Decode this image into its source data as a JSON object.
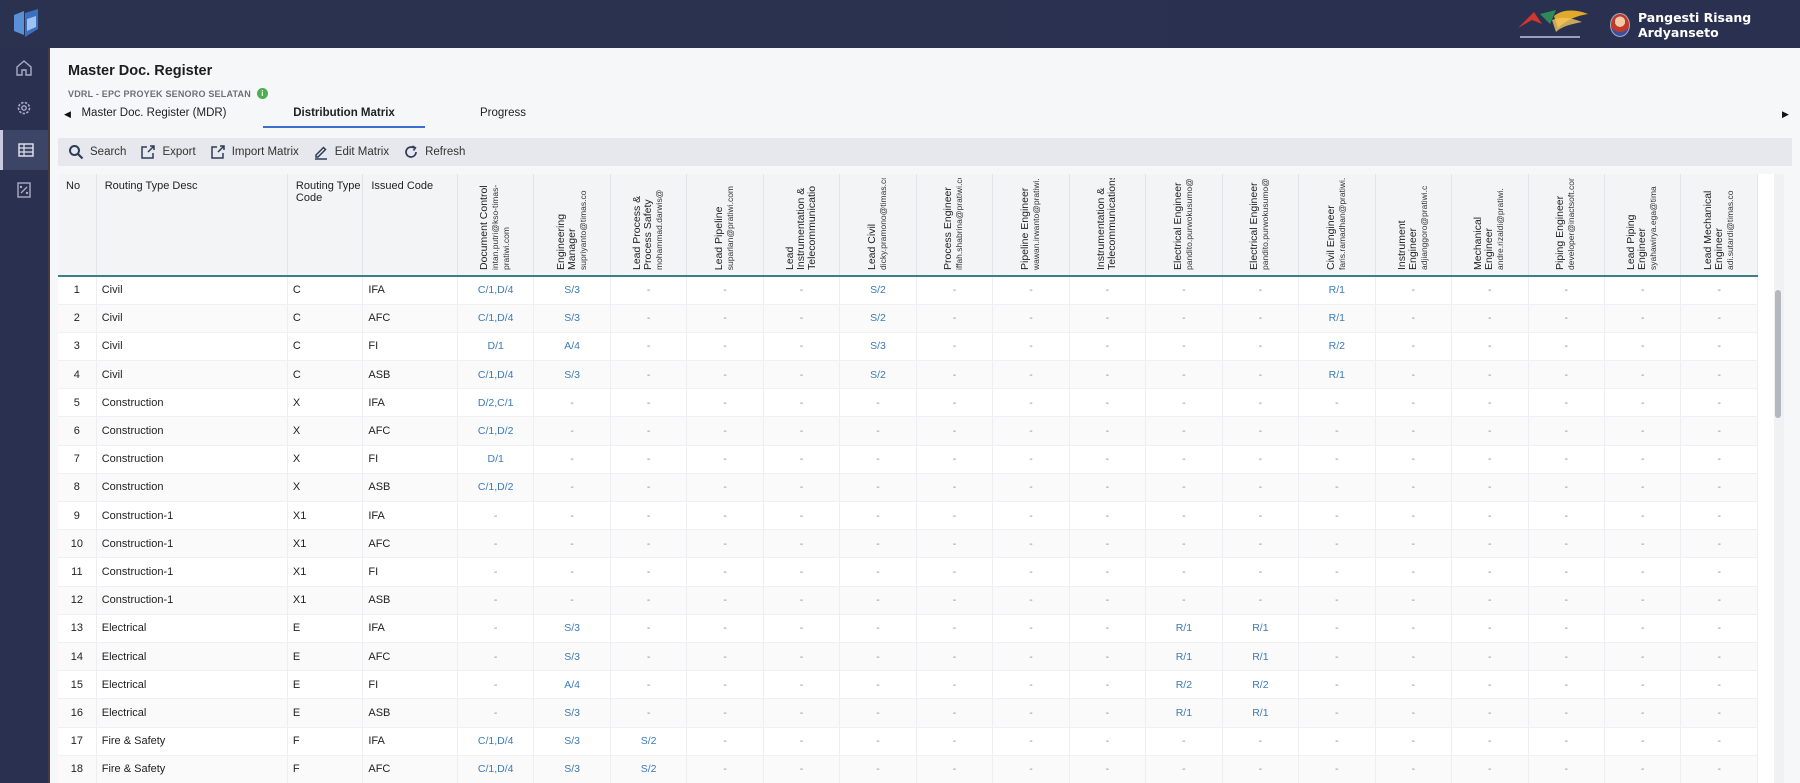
{
  "user": {
    "name": "Pangesti Risang Ardyanseto"
  },
  "rail": {
    "items": [
      "home-icon",
      "gear-icon",
      "grid-icon",
      "report-icon"
    ]
  },
  "page": {
    "title": "Master Doc. Register",
    "subtitle": "VDRL - EPC PROYEK SENORO SELATAN"
  },
  "tabs": [
    {
      "label": "Master Doc. Register (MDR)",
      "active": false
    },
    {
      "label": "Distribution Matrix",
      "active": true
    },
    {
      "label": "Progress",
      "active": false
    }
  ],
  "toolbar": {
    "search": "Search",
    "export": "Export",
    "import": "Import Matrix",
    "edit": "Edit Matrix",
    "refresh": "Refresh"
  },
  "table": {
    "fixed_headers": [
      "No",
      "Routing Type Desc",
      "Routing Type Code",
      "Issued Code"
    ],
    "role_headers": [
      {
        "title": "Document Control",
        "email": "intan.putri@kso-timas-pratiwi.com"
      },
      {
        "title": "Engineering Manager",
        "email": "supriyanto@timas.co"
      },
      {
        "title": "Lead Process & Process Safety",
        "email": "mohammad.darwis@"
      },
      {
        "title": "Lead Pipeline",
        "email": "suparlan@pratiwi.com"
      },
      {
        "title": "Lead Instrumentation & Telecommunicatio",
        "email": ""
      },
      {
        "title": "Lead Civil",
        "email": "dicky.pramono@timas.com"
      },
      {
        "title": "Process Engineer",
        "email": "iffah.shabrina@pratiwi.com"
      },
      {
        "title": "Pipeline Engineer",
        "email": "wawan.irwanto@pratiwi.com"
      },
      {
        "title": "Instrumentation & Telecommunications",
        "email": ""
      },
      {
        "title": "Electrical Engineer",
        "email": "pandito.purwokusumo@pratiwi.com"
      },
      {
        "title": "Electrical Engineer",
        "email": "pandito.purwokusumo@pratiwi.com"
      },
      {
        "title": "Civil Engineer",
        "email": "faris.ramadhan@pratiwi.com"
      },
      {
        "title": "Instrument Engineer",
        "email": "adjianggoro@pratiwi.c"
      },
      {
        "title": "Mechanical Engineer",
        "email": "andre.rizaldi@pratiwi."
      },
      {
        "title": "Piping Engineer",
        "email": "developer@inactsoft.com"
      },
      {
        "title": "Lead Piping Engineer",
        "email": "syahawirya.ega@tima"
      },
      {
        "title": "Lead Mechanical Engineer",
        "email": "adi.sutardi@timas.co"
      }
    ],
    "rows": [
      {
        "no": "1",
        "desc": "Civil",
        "type": "C",
        "issued": "IFA",
        "codes": [
          "C/1,D/4",
          "S/3",
          "-",
          "-",
          "-",
          "S/2",
          "-",
          "-",
          "-",
          "-",
          "-",
          "R/1",
          "-",
          "-",
          "-",
          "-",
          "-"
        ]
      },
      {
        "no": "2",
        "desc": "Civil",
        "type": "C",
        "issued": "AFC",
        "codes": [
          "C/1,D/4",
          "S/3",
          "-",
          "-",
          "-",
          "S/2",
          "-",
          "-",
          "-",
          "-",
          "-",
          "R/1",
          "-",
          "-",
          "-",
          "-",
          "-"
        ]
      },
      {
        "no": "3",
        "desc": "Civil",
        "type": "C",
        "issued": "FI",
        "codes": [
          "D/1",
          "A/4",
          "-",
          "-",
          "-",
          "S/3",
          "-",
          "-",
          "-",
          "-",
          "-",
          "R/2",
          "-",
          "-",
          "-",
          "-",
          "-"
        ]
      },
      {
        "no": "4",
        "desc": "Civil",
        "type": "C",
        "issued": "ASB",
        "codes": [
          "C/1,D/4",
          "S/3",
          "-",
          "-",
          "-",
          "S/2",
          "-",
          "-",
          "-",
          "-",
          "-",
          "R/1",
          "-",
          "-",
          "-",
          "-",
          "-"
        ]
      },
      {
        "no": "5",
        "desc": "Construction",
        "type": "X",
        "issued": "IFA",
        "codes": [
          "D/2,C/1",
          "-",
          "-",
          "-",
          "-",
          "-",
          "-",
          "-",
          "-",
          "-",
          "-",
          "-",
          "-",
          "-",
          "-",
          "-",
          "-"
        ]
      },
      {
        "no": "6",
        "desc": "Construction",
        "type": "X",
        "issued": "AFC",
        "codes": [
          "C/1,D/2",
          "-",
          "-",
          "-",
          "-",
          "-",
          "-",
          "-",
          "-",
          "-",
          "-",
          "-",
          "-",
          "-",
          "-",
          "-",
          "-"
        ]
      },
      {
        "no": "7",
        "desc": "Construction",
        "type": "X",
        "issued": "FI",
        "codes": [
          "D/1",
          "-",
          "-",
          "-",
          "-",
          "-",
          "-",
          "-",
          "-",
          "-",
          "-",
          "-",
          "-",
          "-",
          "-",
          "-",
          "-"
        ]
      },
      {
        "no": "8",
        "desc": "Construction",
        "type": "X",
        "issued": "ASB",
        "codes": [
          "C/1,D/2",
          "-",
          "-",
          "-",
          "-",
          "-",
          "-",
          "-",
          "-",
          "-",
          "-",
          "-",
          "-",
          "-",
          "-",
          "-",
          "-"
        ]
      },
      {
        "no": "9",
        "desc": "Construction-1",
        "type": "X1",
        "issued": "IFA",
        "codes": [
          "-",
          "-",
          "-",
          "-",
          "-",
          "-",
          "-",
          "-",
          "-",
          "-",
          "-",
          "-",
          "-",
          "-",
          "-",
          "-",
          "-"
        ]
      },
      {
        "no": "10",
        "desc": "Construction-1",
        "type": "X1",
        "issued": "AFC",
        "codes": [
          "-",
          "-",
          "-",
          "-",
          "-",
          "-",
          "-",
          "-",
          "-",
          "-",
          "-",
          "-",
          "-",
          "-",
          "-",
          "-",
          "-"
        ]
      },
      {
        "no": "11",
        "desc": "Construction-1",
        "type": "X1",
        "issued": "FI",
        "codes": [
          "-",
          "-",
          "-",
          "-",
          "-",
          "-",
          "-",
          "-",
          "-",
          "-",
          "-",
          "-",
          "-",
          "-",
          "-",
          "-",
          "-"
        ]
      },
      {
        "no": "12",
        "desc": "Construction-1",
        "type": "X1",
        "issued": "ASB",
        "codes": [
          "-",
          "-",
          "-",
          "-",
          "-",
          "-",
          "-",
          "-",
          "-",
          "-",
          "-",
          "-",
          "-",
          "-",
          "-",
          "-",
          "-"
        ]
      },
      {
        "no": "13",
        "desc": "Electrical",
        "type": "E",
        "issued": "IFA",
        "codes": [
          "-",
          "S/3",
          "-",
          "-",
          "-",
          "-",
          "-",
          "-",
          "-",
          "R/1",
          "R/1",
          "-",
          "-",
          "-",
          "-",
          "-",
          "-"
        ]
      },
      {
        "no": "14",
        "desc": "Electrical",
        "type": "E",
        "issued": "AFC",
        "codes": [
          "-",
          "S/3",
          "-",
          "-",
          "-",
          "-",
          "-",
          "-",
          "-",
          "R/1",
          "R/1",
          "-",
          "-",
          "-",
          "-",
          "-",
          "-"
        ]
      },
      {
        "no": "15",
        "desc": "Electrical",
        "type": "E",
        "issued": "FI",
        "codes": [
          "-",
          "A/4",
          "-",
          "-",
          "-",
          "-",
          "-",
          "-",
          "-",
          "R/2",
          "R/2",
          "-",
          "-",
          "-",
          "-",
          "-",
          "-"
        ]
      },
      {
        "no": "16",
        "desc": "Electrical",
        "type": "E",
        "issued": "ASB",
        "codes": [
          "-",
          "S/3",
          "-",
          "-",
          "-",
          "-",
          "-",
          "-",
          "-",
          "R/1",
          "R/1",
          "-",
          "-",
          "-",
          "-",
          "-",
          "-"
        ]
      },
      {
        "no": "17",
        "desc": "Fire & Safety",
        "type": "F",
        "issued": "IFA",
        "codes": [
          "C/1,D/4",
          "S/3",
          "S/2",
          "-",
          "-",
          "-",
          "-",
          "-",
          "-",
          "-",
          "-",
          "-",
          "-",
          "-",
          "-",
          "-",
          "-"
        ]
      },
      {
        "no": "18",
        "desc": "Fire & Safety",
        "type": "F",
        "issued": "AFC",
        "codes": [
          "C/1,D/4",
          "S/3",
          "S/2",
          "-",
          "-",
          "-",
          "-",
          "-",
          "-",
          "-",
          "-",
          "-",
          "-",
          "-",
          "-",
          "-",
          "-"
        ]
      }
    ]
  }
}
